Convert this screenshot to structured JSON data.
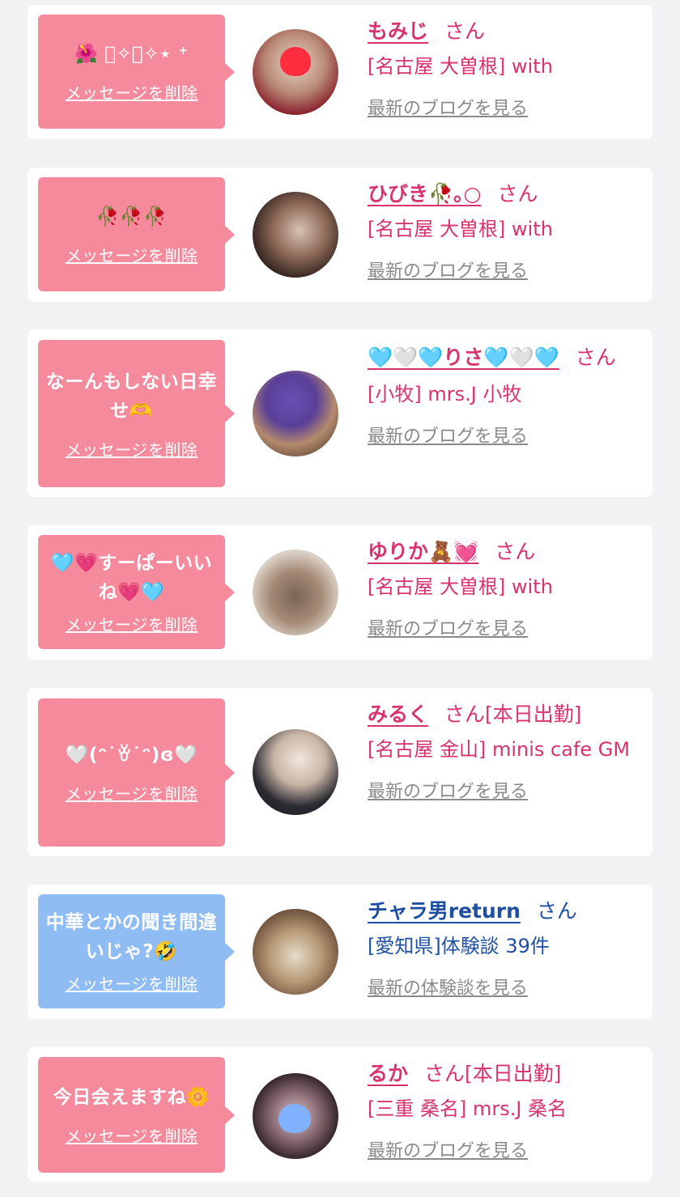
{
  "cards": [
    {
      "message": "🌺 ﾟ✧ﾟ✧⋆ ⁺",
      "delete_label": "メッセージを削除",
      "name": "もみじ",
      "san": "さん",
      "shop": "[名古屋 大曽根] with",
      "link": "最新のブログを見る",
      "bubble": "pink"
    },
    {
      "message": "🥀🥀🥀",
      "delete_label": "メッセージを削除",
      "name": "ひびき🥀｡○",
      "san": "さん",
      "shop": "[名古屋 大曽根] with",
      "link": "最新のブログを見る",
      "bubble": "pink"
    },
    {
      "message": "なーんもしない日幸せ🫶",
      "delete_label": "メッセージを削除",
      "name": "🩵🤍🩵りさ🩵🤍🩵",
      "san": "さん",
      "shop": "[小牧] mrs.J 小牧",
      "link": "最新のブログを見る",
      "bubble": "pink"
    },
    {
      "message": "🩵💗すーぱーいいね💗🩵",
      "delete_label": "メッセージを削除",
      "name": "ゆりか🧸💓",
      "san": "さん",
      "shop": "[名古屋 大曽根] with",
      "link": "最新のブログを見る",
      "bubble": "pink"
    },
    {
      "message": "🤍(ᵔ˙ꈊ˙ᵔ)ɞ🤍",
      "delete_label": "メッセージを削除",
      "name": "みるく",
      "san": "さん[本日出勤]",
      "shop": "[名古屋 金山] minis cafe GM",
      "link": "最新のブログを見る",
      "bubble": "pink"
    },
    {
      "message": "中華とかの聞き間違いじゃ?🤣",
      "delete_label": "メッセージを削除",
      "name": "チャラ男return",
      "san": "さん",
      "shop": "[愛知県]体験談 39件",
      "link": "最新の体験談を見る",
      "bubble": "blue"
    },
    {
      "message": "今日会えますね🌼",
      "delete_label": "メッセージを削除",
      "name": "るか",
      "san": "さん[本日出勤]",
      "shop": "[三重 桑名] mrs.J 桑名",
      "link": "最新のブログを見る",
      "bubble": "pink"
    }
  ]
}
